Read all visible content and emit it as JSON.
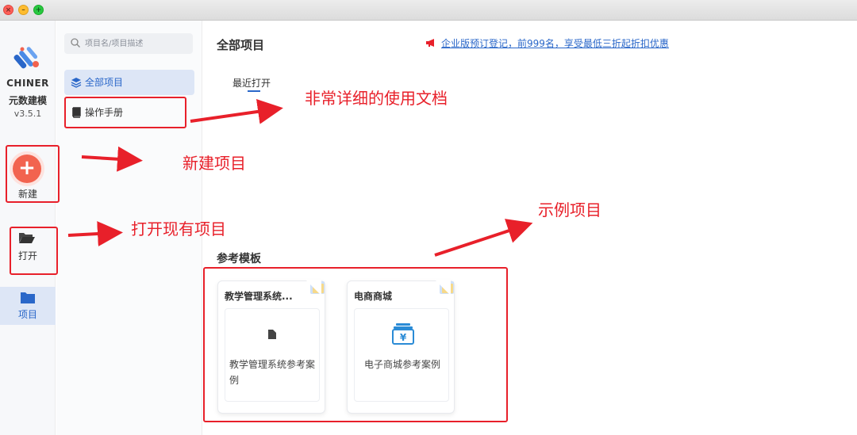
{
  "window": {
    "controls": [
      "close",
      "minimize",
      "zoom"
    ]
  },
  "rail": {
    "app_name": "CHINER",
    "app_subtitle": "元数建模",
    "version": "v3.5.1",
    "new_label": "新建",
    "open_label": "打开",
    "projects_label": "项目"
  },
  "sidebar": {
    "search_placeholder": "项目名/项目描述",
    "items": [
      {
        "label": "全部项目",
        "icon": "layers-icon",
        "active": true
      },
      {
        "label": "操作手册",
        "icon": "book-icon",
        "active": false
      }
    ]
  },
  "main": {
    "title": "全部项目",
    "promo_text": "企业版预订登记，前999名，享受最低三折起折扣优惠",
    "recent_tab": "最近打开",
    "templates_title": "参考模板",
    "templates": [
      {
        "title": "教学管理系统...",
        "description": "教学管理系统参考案例",
        "icon": "file-icon"
      },
      {
        "title": "电商商城",
        "description": "电子商城参考案例",
        "icon": "yuan-box-icon"
      }
    ]
  },
  "annotations": {
    "manual_note": "非常详细的使用文档",
    "new_note": "新建项目",
    "open_note": "打开现有项目",
    "sample_note": "示例项目"
  },
  "colors": {
    "accent": "#2a67c9",
    "new_button": "#f2634f",
    "annotation": "#e8202a",
    "selection_bg": "#dde6f6"
  }
}
